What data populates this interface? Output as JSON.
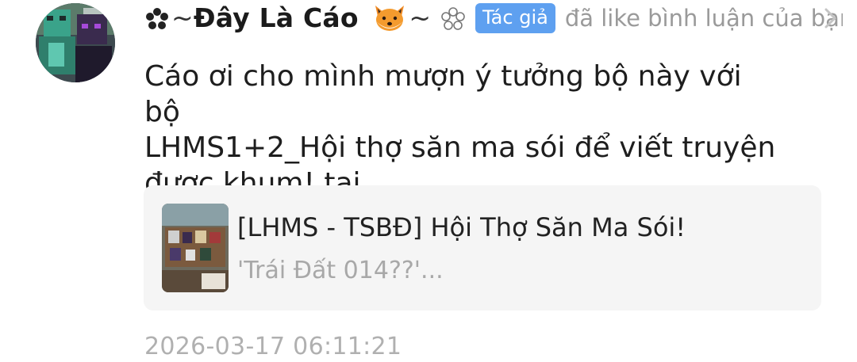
{
  "notification": {
    "avatar_icon": "user-avatar-icon",
    "user": {
      "prefix": "~",
      "name": "Đây Là Cáo",
      "suffix": "~",
      "icons": [
        "flower-icon",
        "fox-face-icon",
        "flower-outline-icon"
      ]
    },
    "author_badge": "Tác giả",
    "action": "đã like bình luận của bạn",
    "chevron_icon": "chevron-right-icon",
    "comment": {
      "line1": "Cáo ơi cho mình mượn ý tưởng bộ này với bộ",
      "line2": "LHMS1+2_Hội thợ săn ma sói để viết truyện",
      "line3": "được khum! tại"
    },
    "story_card": {
      "title": "[LHMS - TSBĐ] Hội Thợ Săn Ma Sói!",
      "subtitle": "'Trái Đất 014??'...",
      "thumbnail_icon": "story-cover-thumbnail"
    },
    "timestamp": "2026-03-17 06:11:21"
  },
  "colors": {
    "badge_bg": "#5ea0f0",
    "muted_text": "#9a9a9a",
    "card_bg": "#f5f5f5"
  }
}
